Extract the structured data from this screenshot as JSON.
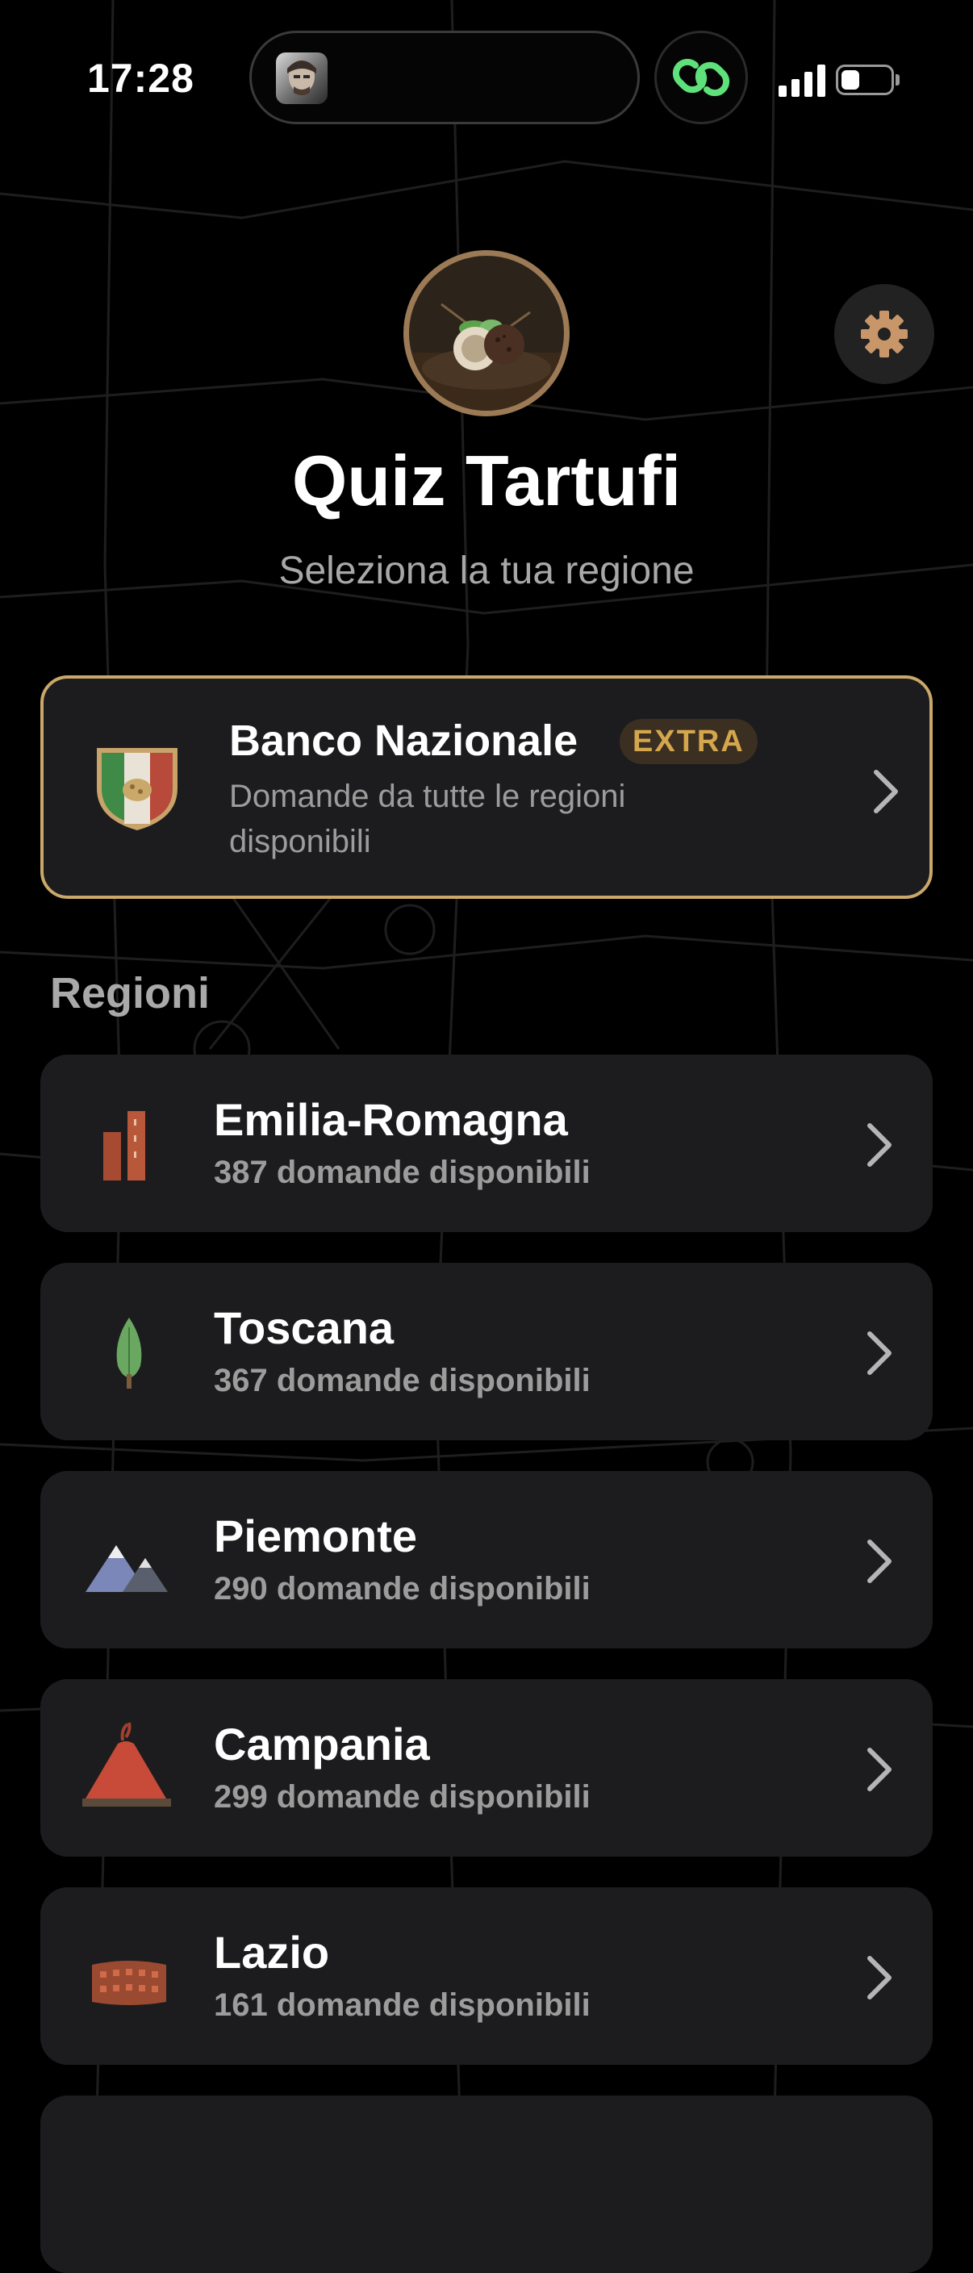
{
  "status_bar": {
    "time": "17:28"
  },
  "header": {
    "title": "Quiz Tartufi",
    "subtitle": "Seleziona la tua regione"
  },
  "banco": {
    "title": "Banco Nazionale",
    "badge": "EXTRA",
    "description": "Domande da tutte le regioni disponibili"
  },
  "section_title": "Regioni",
  "regions": [
    {
      "name": "Emilia-Romagna",
      "count": "387 domande disponibili",
      "icon": "towers-icon"
    },
    {
      "name": "Toscana",
      "count": "367 domande disponibili",
      "icon": "cypress-icon"
    },
    {
      "name": "Piemonte",
      "count": "290 domande disponibili",
      "icon": "mountains-icon"
    },
    {
      "name": "Campania",
      "count": "299 domande disponibili",
      "icon": "volcano-icon"
    },
    {
      "name": "Lazio",
      "count": "161 domande disponibili",
      "icon": "colosseum-icon"
    }
  ],
  "colors": {
    "background": "#000000",
    "card": "#1c1c1e",
    "accent_gold": "#c9a86a",
    "badge_text": "#d4a64e",
    "secondary_text": "#9c9c9c"
  }
}
